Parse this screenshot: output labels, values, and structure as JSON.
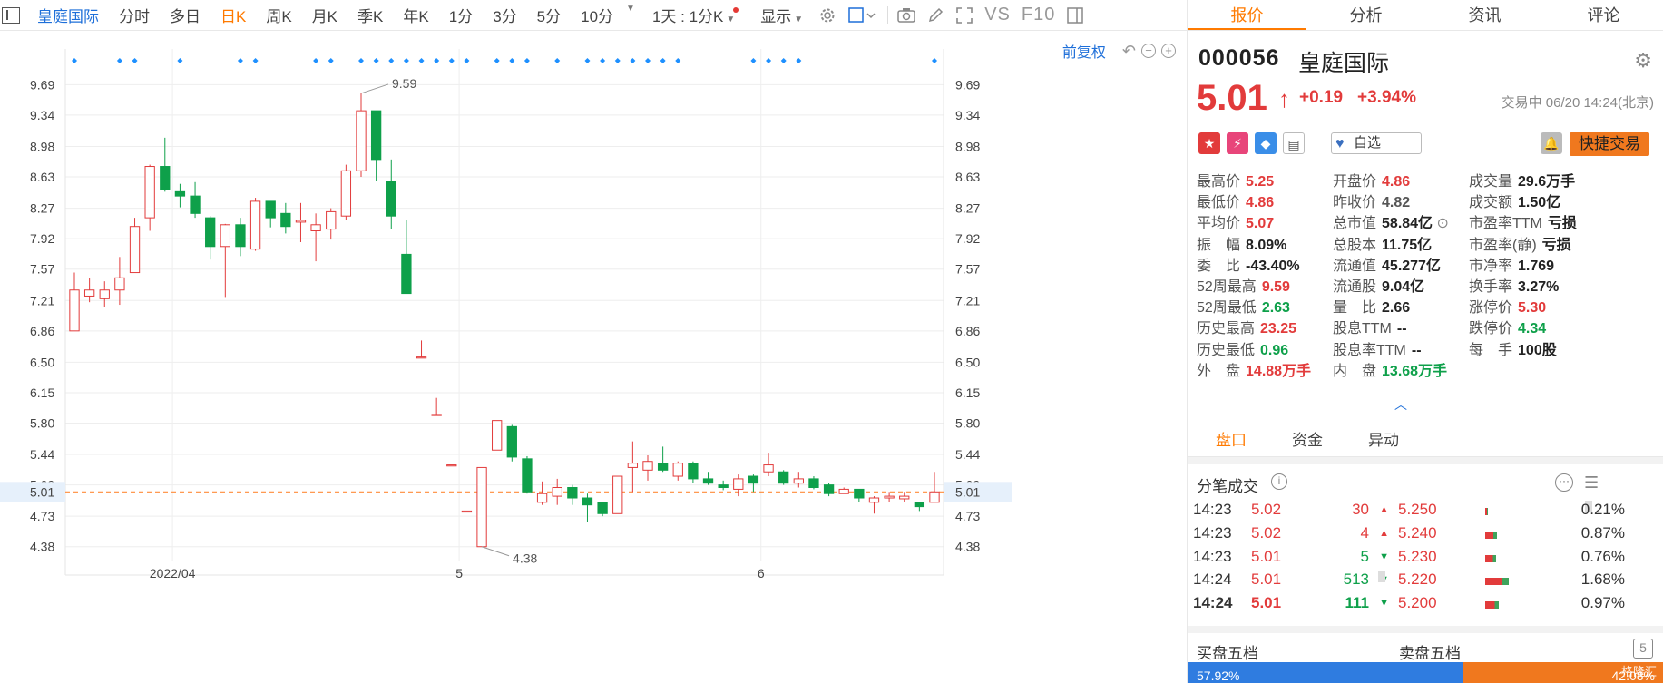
{
  "toolbar": {
    "items": [
      {
        "label": "皇庭国际",
        "style": "blue"
      },
      {
        "label": "分时",
        "style": ""
      },
      {
        "label": "多日",
        "style": ""
      },
      {
        "label": "日K",
        "style": "active"
      },
      {
        "label": "周K",
        "style": ""
      },
      {
        "label": "月K",
        "style": ""
      },
      {
        "label": "季K",
        "style": ""
      },
      {
        "label": "年K",
        "style": ""
      },
      {
        "label": "1分",
        "style": ""
      },
      {
        "label": "3分",
        "style": ""
      },
      {
        "label": "5分",
        "style": ""
      },
      {
        "label": "10分",
        "style": ""
      }
    ],
    "ratio_label": "1天 : 1分K",
    "display_label": "显示",
    "vs_label": "VS",
    "f10_label": "F10"
  },
  "chart": {
    "adjust_label": "前复权",
    "colors": {
      "up": "#e23b3b",
      "down": "#0ea04a",
      "marker": "#1e90ff",
      "current": "#ff8c3a",
      "grid": "#eeeeee"
    }
  },
  "chart_data": {
    "type": "candlestick",
    "title": "",
    "y_ticks": [
      9.69,
      9.34,
      8.98,
      8.63,
      8.27,
      7.92,
      7.57,
      7.21,
      6.86,
      6.5,
      6.15,
      5.8,
      5.44,
      5.09,
      4.73,
      4.38
    ],
    "y_range": [
      4.2,
      9.85
    ],
    "x_labels": [
      {
        "label": "2022/04",
        "index": 7
      },
      {
        "label": "5",
        "index": 26
      },
      {
        "label": "6",
        "index": 46
      }
    ],
    "current_price": 5.01,
    "max_label": "9.59",
    "min_label": "4.38",
    "candles": [
      {
        "o": 6.86,
        "c": 7.33,
        "h": 7.53,
        "l": 6.86
      },
      {
        "o": 7.26,
        "c": 7.33,
        "h": 7.47,
        "l": 7.19
      },
      {
        "o": 7.23,
        "c": 7.33,
        "h": 7.43,
        "l": 7.13
      },
      {
        "o": 7.33,
        "c": 7.47,
        "h": 7.71,
        "l": 7.16
      },
      {
        "o": 7.53,
        "c": 8.06,
        "h": 8.16,
        "l": 7.53
      },
      {
        "o": 8.16,
        "c": 8.75,
        "h": 8.77,
        "l": 8.01
      },
      {
        "o": 8.75,
        "c": 8.48,
        "h": 9.08,
        "l": 8.46
      },
      {
        "o": 8.46,
        "c": 8.41,
        "h": 8.55,
        "l": 8.28
      },
      {
        "o": 8.41,
        "c": 8.21,
        "h": 8.57,
        "l": 8.16
      },
      {
        "o": 8.16,
        "c": 7.83,
        "h": 8.18,
        "l": 7.68
      },
      {
        "o": 7.83,
        "c": 8.08,
        "h": 8.09,
        "l": 7.25
      },
      {
        "o": 8.08,
        "c": 7.83,
        "h": 8.16,
        "l": 7.72
      },
      {
        "o": 7.8,
        "c": 8.35,
        "h": 8.39,
        "l": 7.78
      },
      {
        "o": 8.35,
        "c": 8.16,
        "h": 8.35,
        "l": 8.05
      },
      {
        "o": 8.21,
        "c": 8.06,
        "h": 8.33,
        "l": 7.98
      },
      {
        "o": 8.11,
        "c": 8.13,
        "h": 8.33,
        "l": 7.88
      },
      {
        "o": 8.01,
        "c": 8.08,
        "h": 8.21,
        "l": 7.66
      },
      {
        "o": 8.03,
        "c": 8.23,
        "h": 8.27,
        "l": 7.91
      },
      {
        "o": 8.18,
        "c": 8.7,
        "h": 8.77,
        "l": 8.13
      },
      {
        "o": 8.7,
        "c": 9.39,
        "h": 9.59,
        "l": 8.63
      },
      {
        "o": 9.39,
        "c": 8.83,
        "h": 9.39,
        "l": 8.58
      },
      {
        "o": 8.58,
        "c": 8.18,
        "h": 8.83,
        "l": 8.03
      },
      {
        "o": 7.74,
        "c": 7.29,
        "h": 8.13,
        "l": 7.29
      },
      {
        "o": 6.56,
        "c": 6.56,
        "h": 6.75,
        "l": 6.56
      },
      {
        "o": 5.9,
        "c": 5.9,
        "h": 6.09,
        "l": 5.9
      },
      {
        "o": 5.32,
        "c": 5.32,
        "h": 5.32,
        "l": 5.32
      },
      {
        "o": 4.79,
        "c": 4.79,
        "h": 4.79,
        "l": 4.79
      },
      {
        "o": 4.38,
        "c": 5.29,
        "h": 5.29,
        "l": 4.38
      },
      {
        "o": 5.49,
        "c": 5.83,
        "h": 5.83,
        "l": 5.49
      },
      {
        "o": 5.76,
        "c": 5.41,
        "h": 5.78,
        "l": 5.36
      },
      {
        "o": 5.39,
        "c": 5.01,
        "h": 5.42,
        "l": 4.99
      },
      {
        "o": 4.89,
        "c": 4.99,
        "h": 5.13,
        "l": 4.86
      },
      {
        "o": 4.96,
        "c": 5.06,
        "h": 5.16,
        "l": 4.86
      },
      {
        "o": 5.06,
        "c": 4.94,
        "h": 5.09,
        "l": 4.86
      },
      {
        "o": 4.94,
        "c": 4.86,
        "h": 4.99,
        "l": 4.66
      },
      {
        "o": 4.89,
        "c": 4.76,
        "h": 4.89,
        "l": 4.73
      },
      {
        "o": 4.76,
        "c": 5.19,
        "h": 5.19,
        "l": 4.76
      },
      {
        "o": 5.29,
        "c": 5.34,
        "h": 5.59,
        "l": 5.01
      },
      {
        "o": 5.26,
        "c": 5.36,
        "h": 5.43,
        "l": 5.14
      },
      {
        "o": 5.34,
        "c": 5.26,
        "h": 5.53,
        "l": 5.24
      },
      {
        "o": 5.19,
        "c": 5.34,
        "h": 5.36,
        "l": 5.14
      },
      {
        "o": 5.34,
        "c": 5.16,
        "h": 5.36,
        "l": 5.11
      },
      {
        "o": 5.16,
        "c": 5.11,
        "h": 5.24,
        "l": 5.09
      },
      {
        "o": 5.09,
        "c": 5.06,
        "h": 5.14,
        "l": 5.03
      },
      {
        "o": 5.04,
        "c": 5.16,
        "h": 5.21,
        "l": 4.96
      },
      {
        "o": 5.19,
        "c": 5.11,
        "h": 5.21,
        "l": 5.01
      },
      {
        "o": 5.24,
        "c": 5.32,
        "h": 5.46,
        "l": 5.19
      },
      {
        "o": 5.24,
        "c": 5.11,
        "h": 5.26,
        "l": 5.09
      },
      {
        "o": 5.11,
        "c": 5.16,
        "h": 5.24,
        "l": 5.06
      },
      {
        "o": 5.16,
        "c": 5.06,
        "h": 5.19,
        "l": 5.04
      },
      {
        "o": 5.09,
        "c": 4.99,
        "h": 5.11,
        "l": 4.96
      },
      {
        "o": 4.99,
        "c": 5.04,
        "h": 5.06,
        "l": 4.99
      },
      {
        "o": 5.04,
        "c": 4.94,
        "h": 5.04,
        "l": 4.89
      },
      {
        "o": 4.89,
        "c": 4.94,
        "h": 4.96,
        "l": 4.76
      },
      {
        "o": 4.94,
        "c": 4.96,
        "h": 5.01,
        "l": 4.89
      },
      {
        "o": 4.93,
        "c": 4.96,
        "h": 5.01,
        "l": 4.89
      },
      {
        "o": 4.89,
        "c": 4.84,
        "h": 4.89,
        "l": 4.79
      },
      {
        "o": 4.89,
        "c": 5.01,
        "h": 5.24,
        "l": 4.89
      }
    ],
    "marker_indices": [
      0,
      3,
      4,
      7,
      11,
      12,
      16,
      17,
      19,
      20,
      21,
      22,
      23,
      24,
      25,
      26,
      28,
      29,
      30,
      32,
      34,
      35,
      36,
      37,
      38,
      39,
      40,
      45,
      46,
      47,
      48,
      57
    ]
  },
  "panel": {
    "tabs": [
      {
        "label": "报价",
        "active": true
      },
      {
        "label": "分析",
        "active": false
      },
      {
        "label": "资讯",
        "active": false
      },
      {
        "label": "评论",
        "active": false
      }
    ],
    "code": "000056",
    "name": "皇庭国际",
    "price": "5.01",
    "change": "+0.19",
    "change_pct": "+3.94%",
    "status": "交易中 06/20 14:24(北京)",
    "favorite_label": "自选",
    "trade_label": "快捷交易",
    "stats": [
      [
        {
          "label": "最高价",
          "value": "5.25",
          "color": "red"
        },
        {
          "label": "最低价",
          "value": "4.86",
          "color": "red"
        },
        {
          "label": "平均价",
          "value": "5.07",
          "color": "red"
        },
        {
          "label": "振　幅",
          "value": "8.09%",
          "color": "dark"
        },
        {
          "label": "委　比",
          "value": "-43.40%",
          "color": "dark"
        },
        {
          "label": "52周最高",
          "value": "9.59",
          "color": "red"
        },
        {
          "label": "52周最低",
          "value": "2.63",
          "color": "green"
        },
        {
          "label": "历史最高",
          "value": "23.25",
          "color": "red"
        },
        {
          "label": "历史最低",
          "value": "0.96",
          "color": "green"
        },
        {
          "label": "外　盘",
          "value": "14.88万手",
          "color": "red"
        }
      ],
      [
        {
          "label": "开盘价",
          "value": "4.86",
          "color": "red"
        },
        {
          "label": "昨收价",
          "value": "4.82",
          "color": "gray"
        },
        {
          "label": "总市值",
          "value": "58.84亿",
          "color": "dark"
        },
        {
          "label": "总股本",
          "value": "11.75亿",
          "color": "dark"
        },
        {
          "label": "流通值",
          "value": "45.277亿",
          "color": "dark"
        },
        {
          "label": "流通股",
          "value": "9.04亿",
          "color": "dark"
        },
        {
          "label": "量　比",
          "value": "2.66",
          "color": "dark"
        },
        {
          "label": "股息TTM",
          "value": "--",
          "color": "dark"
        },
        {
          "label": "股息率TTM",
          "value": "--",
          "color": "dark"
        },
        {
          "label": "内　盘",
          "value": "13.68万手",
          "color": "green"
        }
      ],
      [
        {
          "label": "成交量",
          "value": "29.6万手",
          "color": "dark"
        },
        {
          "label": "成交额",
          "value": "1.50亿",
          "color": "dark"
        },
        {
          "label": "市盈率TTM",
          "value": "亏损",
          "color": "dark"
        },
        {
          "label": "市盈率(静)",
          "value": "亏损",
          "color": "dark"
        },
        {
          "label": "市净率",
          "value": "1.769",
          "color": "dark"
        },
        {
          "label": "换手率",
          "value": "3.27%",
          "color": "dark"
        },
        {
          "label": "涨停价",
          "value": "5.30",
          "color": "red"
        },
        {
          "label": "跌停价",
          "value": "4.34",
          "color": "green"
        },
        {
          "label": "每　手",
          "value": "100股",
          "color": "dark"
        }
      ]
    ],
    "subtabs": [
      {
        "label": "盘口",
        "active": true
      },
      {
        "label": "资金",
        "active": false
      },
      {
        "label": "异动",
        "active": false
      }
    ],
    "trades_title": "分笔成交",
    "trades": [
      {
        "time": "14:23",
        "price": "5.02",
        "vol": "30",
        "dir": "up"
      },
      {
        "time": "14:23",
        "price": "5.02",
        "vol": "4",
        "dir": "up"
      },
      {
        "time": "14:23",
        "price": "5.01",
        "vol": "5",
        "dir": "down"
      },
      {
        "time": "14:24",
        "price": "5.01",
        "vol": "513",
        "dir": "down"
      },
      {
        "time": "14:24",
        "price": "5.01",
        "vol": "111",
        "dir": "down"
      }
    ],
    "levels": [
      {
        "price": "5.250",
        "pct": "0.21%",
        "pct_value": 0.21
      },
      {
        "price": "5.240",
        "pct": "0.87%",
        "pct_value": 0.87
      },
      {
        "price": "5.230",
        "pct": "0.76%",
        "pct_value": 0.76
      },
      {
        "price": "5.220",
        "pct": "1.68%",
        "pct_value": 1.68
      },
      {
        "price": "5.200",
        "pct": "0.97%",
        "pct_value": 0.97
      }
    ],
    "buy5_label": "买盘五档",
    "sell5_label": "卖盘五档",
    "five_label": "5",
    "buy_ratio": "57.92%",
    "sell_ratio": "42.08%",
    "buy_ratio_value": 57.92,
    "watermark": "格隆汇"
  }
}
